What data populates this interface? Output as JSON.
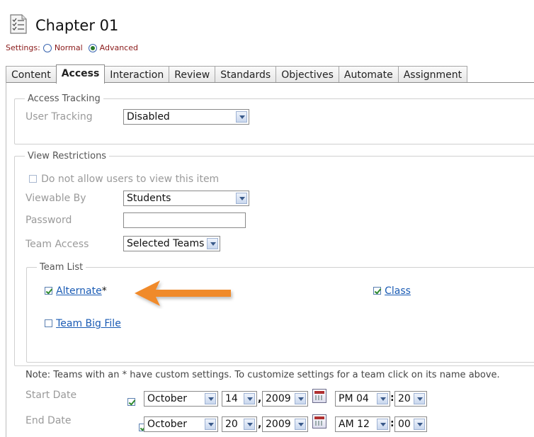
{
  "header": {
    "title": "Chapter 01",
    "icon": "checklist-page-icon"
  },
  "settings": {
    "label": "Settings:",
    "options": [
      "Normal",
      "Advanced"
    ],
    "selected": "Advanced"
  },
  "tabs": [
    {
      "label": "Content"
    },
    {
      "label": "Access",
      "active": true
    },
    {
      "label": "Interaction"
    },
    {
      "label": "Review"
    },
    {
      "label": "Standards"
    },
    {
      "label": "Objectives"
    },
    {
      "label": "Automate"
    },
    {
      "label": "Assignment"
    }
  ],
  "access_tracking": {
    "legend": "Access Tracking",
    "user_tracking_label": "User Tracking",
    "user_tracking_value": "Disabled"
  },
  "view_restrictions": {
    "legend": "View Restrictions",
    "no_view_label": "Do not allow users to view this item",
    "viewable_by_label": "Viewable By",
    "viewable_by_value": "Students",
    "password_label": "Password",
    "password_value": "",
    "team_access_label": "Team Access",
    "team_access_value": "Selected Teams"
  },
  "team_list": {
    "legend": "Team List",
    "teams": [
      {
        "name": "Alternate",
        "suffix": "*",
        "checked": true
      },
      {
        "name": "Class",
        "checked": true
      },
      {
        "name": "Team Big File",
        "checked": false
      }
    ]
  },
  "note": "Note: Teams with an * have custom settings. To customize settings for a team click on its name above.",
  "start_date": {
    "label": "Start Date",
    "checked": true,
    "month": "October",
    "day": "14",
    "year": "2009",
    "hour": "PM 04",
    "minute": "20"
  },
  "end_date": {
    "label": "End Date",
    "checked": true,
    "month": "October",
    "day": "20",
    "year": "2009",
    "hour": "AM 12",
    "minute": "00"
  },
  "colors": {
    "accent_arrow": "#f08a2c",
    "link": "#1a5bb4",
    "settings_text": "#8a1a1a"
  }
}
